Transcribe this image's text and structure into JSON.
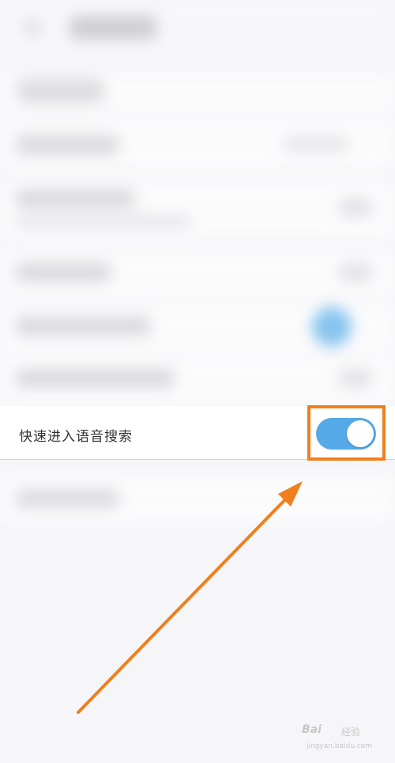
{
  "setting_row": {
    "label": "快速进入语音搜索",
    "toggle_state": "on"
  },
  "colors": {
    "toggle_on": "#55a9e6",
    "highlight": "#f07f1c"
  },
  "watermark": {
    "brand": "Bai",
    "jingyan": "经验",
    "url": "jingyan.baidu.com"
  }
}
